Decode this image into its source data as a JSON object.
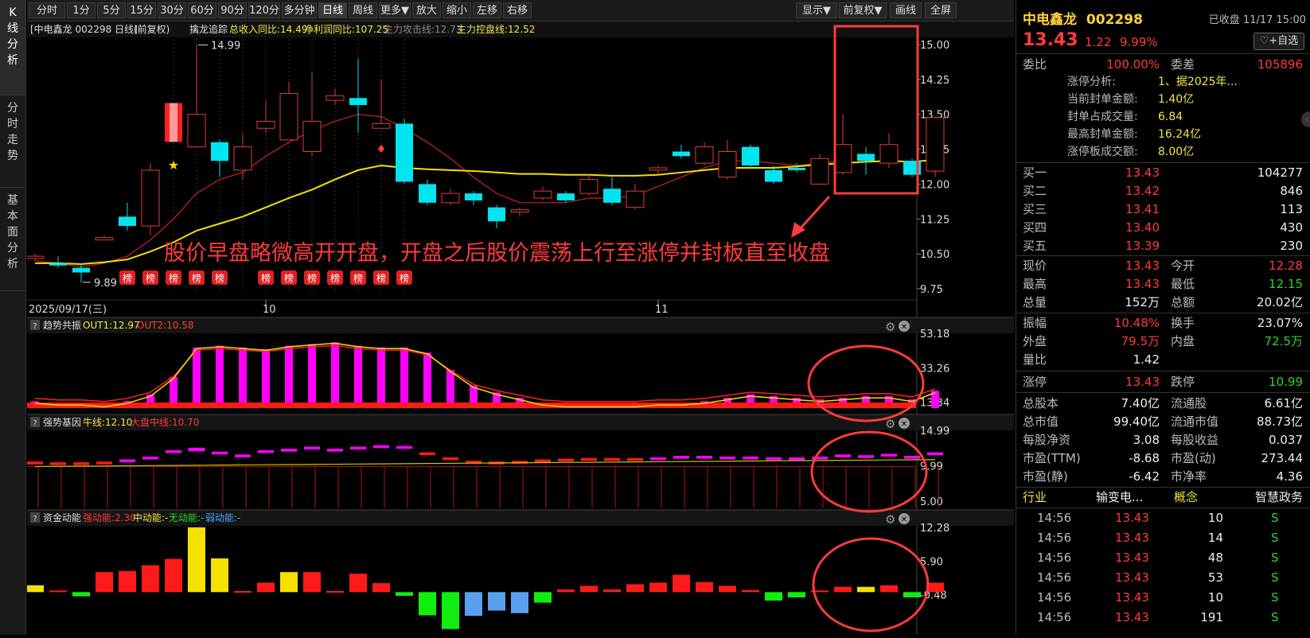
{
  "left_tabs": [
    {
      "label": [
        "K",
        "线",
        "分",
        "析"
      ],
      "active": true
    },
    {
      "label": [
        "分",
        "时",
        "走",
        "势"
      ],
      "active": false
    },
    {
      "label": [
        "基",
        "本",
        "面",
        "分",
        "析"
      ],
      "active": false
    }
  ],
  "toolbar": {
    "left_buttons": [
      "分时",
      "1分",
      "5分",
      "15分",
      "30分",
      "60分",
      "90分",
      "120分",
      "多分钟",
      "日线",
      "周线",
      "更多▼",
      "放大",
      "缩小",
      "左移",
      "右移"
    ],
    "active": "日线",
    "right_buttons": [
      "显示▼",
      "前复权▼",
      "画线",
      "全屏"
    ]
  },
  "main_chart": {
    "header_name": "[中电鑫龙 002298 日线]",
    "header_adj": "(前复权)",
    "indicator_name": "擒龙追踪",
    "ind1": "总收入同比:14.49",
    "ind2": "净利润同比:107.25",
    "ind3": "主力攻击线:12.73",
    "ind4": "主力控盘线:12.52",
    "y_ticks": [
      "15.00",
      "14.25",
      "13.50",
      "12.75",
      "12.00",
      "11.25",
      "10.50",
      "9.75"
    ],
    "high_label": "14.99",
    "low_label": "9.89",
    "annotation": "股价早盘略微高开开盘，开盘之后股价震荡上行至涨停并封板直至收盘",
    "bang_label": "榜",
    "date_start": "2025/09/17(三)",
    "month_10": "10",
    "month_11": "11"
  },
  "sub1": {
    "name": "趋势共振",
    "out1": "OUT1:12.97",
    "out2": "OUT2:10.58",
    "ticks": [
      "53.18",
      "33.26",
      "13.34"
    ]
  },
  "sub2": {
    "name": "强势基因",
    "l1": "牛线:12.10",
    "l2": "大盘中线:10.70",
    "ticks": [
      "14.99",
      "9.99",
      "5.00"
    ]
  },
  "sub3": {
    "name": "资金动能",
    "l1": "强动能:2.30",
    "l2": "中动能:-",
    "l3": "无动能:-",
    "l4": "弱动能:-",
    "ticks": [
      "12.28",
      "5.90",
      "-0.48"
    ]
  },
  "panel": {
    "name": "中电鑫龙",
    "code": "002298",
    "status": "已收盘 11/17 15:00",
    "price": "13.43",
    "change": "1.22",
    "pct": "9.99%",
    "add_btn": "+自选",
    "weibi_l": "委比",
    "weibi_v": "100.00%",
    "weicha_l": "委差",
    "weicha_v": "105896",
    "zt_lines": [
      {
        "k": "涨停分析:",
        "v": "1、据2025年..."
      },
      {
        "k": "当前封单金额:",
        "v": "1.40亿"
      },
      {
        "k": "封单占成交量:",
        "v": "6.84"
      },
      {
        "k": "最高封单金额:",
        "v": "16.24亿"
      },
      {
        "k": "涨停板成交额:",
        "v": "8.00亿"
      }
    ],
    "bids": [
      {
        "k": "买一",
        "p": "13.43",
        "v": "104277"
      },
      {
        "k": "买二",
        "p": "13.42",
        "v": "846"
      },
      {
        "k": "买三",
        "p": "13.41",
        "v": "113"
      },
      {
        "k": "买四",
        "p": "13.40",
        "v": "430"
      },
      {
        "k": "买五",
        "p": "13.39",
        "v": "230"
      }
    ],
    "stats1": [
      {
        "k1": "现价",
        "v1": "13.43",
        "c1": "red",
        "k2": "今开",
        "v2": "12.28",
        "c2": "red"
      },
      {
        "k1": "最高",
        "v1": "13.43",
        "c1": "red",
        "k2": "最低",
        "v2": "12.15",
        "c2": "green"
      },
      {
        "k1": "总量",
        "v1": "152万",
        "c1": "white",
        "k2": "总额",
        "v2": "20.02亿",
        "c2": "white"
      }
    ],
    "stats2": [
      {
        "k1": "振幅",
        "v1": "10.48%",
        "c1": "red",
        "k2": "换手",
        "v2": "23.07%",
        "c2": "white"
      },
      {
        "k1": "外盘",
        "v1": "79.5万",
        "c1": "red",
        "k2": "内盘",
        "v2": "72.5万",
        "c2": "green"
      },
      {
        "k1": "量比",
        "v1": "1.42",
        "c1": "white",
        "k2": "",
        "v2": "",
        "c2": "white"
      }
    ],
    "limit": {
      "k1": "涨停",
      "v1": "13.43",
      "k2": "跌停",
      "v2": "10.99"
    },
    "stats3": [
      {
        "k1": "总股本",
        "v1": "7.40亿",
        "k2": "流通股",
        "v2": "6.61亿"
      },
      {
        "k1": "总市值",
        "v1": "99.40亿",
        "k2": "流通市值",
        "v2": "88.73亿"
      },
      {
        "k1": "每股净资",
        "v1": "3.08",
        "k2": "每股收益",
        "v2": "0.037"
      },
      {
        "k1": "市盈(TTM)",
        "v1": "-8.68",
        "k2": "市盈(动)",
        "v2": "273.44"
      },
      {
        "k1": "市盈(静)",
        "v1": "-6.42",
        "k2": "市净率",
        "v2": "4.36"
      }
    ],
    "industry": {
      "k1": "行业",
      "v1": "输变电...",
      "k2": "概念",
      "v2": "智慧政务"
    },
    "ticks": [
      {
        "t": "14:56",
        "p": "13.43",
        "v": "10",
        "s": "S"
      },
      {
        "t": "14:56",
        "p": "13.43",
        "v": "14",
        "s": "S"
      },
      {
        "t": "14:56",
        "p": "13.43",
        "v": "48",
        "s": "S"
      },
      {
        "t": "14:56",
        "p": "13.43",
        "v": "53",
        "s": "S"
      },
      {
        "t": "14:56",
        "p": "13.43",
        "v": "10",
        "s": "S"
      },
      {
        "t": "14:56",
        "p": "13.43",
        "v": "191",
        "s": "S"
      }
    ]
  },
  "chart_data": {
    "type": "candlestick",
    "ylim": [
      9.75,
      15.0
    ],
    "candles": [
      [
        10.4,
        10.45,
        10.5,
        10.35
      ],
      [
        10.3,
        10.25,
        10.45,
        10.2
      ],
      [
        10.2,
        10.1,
        10.3,
        9.89
      ],
      [
        10.8,
        10.85,
        10.9,
        10.8
      ],
      [
        11.3,
        11.1,
        11.6,
        11.0
      ],
      [
        11.1,
        12.3,
        12.45,
        10.9
      ],
      [
        13.25,
        13.4,
        13.45,
        13.25
      ],
      [
        12.8,
        13.5,
        14.99,
        12.8
      ],
      [
        12.9,
        12.5,
        12.95,
        12.15
      ],
      [
        12.3,
        12.8,
        13.1,
        12.1
      ],
      [
        13.2,
        13.35,
        13.8,
        13.1
      ],
      [
        12.95,
        13.95,
        14.2,
        12.95
      ],
      [
        12.7,
        13.35,
        14.4,
        12.6
      ],
      [
        13.8,
        13.9,
        14.05,
        13.7
      ],
      [
        13.85,
        13.7,
        14.7,
        13.1
      ],
      [
        13.2,
        13.3,
        14.25,
        13.2
      ],
      [
        13.3,
        12.05,
        13.4,
        12.0
      ],
      [
        12.0,
        11.6,
        12.1,
        11.55
      ],
      [
        11.6,
        11.8,
        11.9,
        11.55
      ],
      [
        11.8,
        11.65,
        11.85,
        11.55
      ],
      [
        11.5,
        11.2,
        11.55,
        11.05
      ],
      [
        11.4,
        11.45,
        11.5,
        11.3
      ],
      [
        11.7,
        11.85,
        11.95,
        11.65
      ],
      [
        11.8,
        11.65,
        11.85,
        11.6
      ],
      [
        11.8,
        12.1,
        12.2,
        11.75
      ],
      [
        11.9,
        11.6,
        12.15,
        11.55
      ],
      [
        11.5,
        11.85,
        12.0,
        11.45
      ],
      [
        12.3,
        12.35,
        12.4,
        12.2
      ],
      [
        12.7,
        12.6,
        12.85,
        12.55
      ],
      [
        12.45,
        12.8,
        12.9,
        12.4
      ],
      [
        12.15,
        12.7,
        12.95,
        12.1
      ],
      [
        12.8,
        12.4,
        12.85,
        12.35
      ],
      [
        12.3,
        12.05,
        12.4,
        12.0
      ],
      [
        12.35,
        12.3,
        12.45,
        12.25
      ],
      [
        12.0,
        12.55,
        12.65,
        12.0
      ],
      [
        12.25,
        12.85,
        13.5,
        12.2
      ],
      [
        12.65,
        12.5,
        12.8,
        12.2
      ],
      [
        12.45,
        12.85,
        13.1,
        12.35
      ],
      [
        12.5,
        12.2,
        12.55,
        12.15
      ],
      [
        12.28,
        13.43,
        13.43,
        12.15
      ]
    ],
    "ma_yellow": [
      10.3,
      10.3,
      10.28,
      10.32,
      10.38,
      10.55,
      10.75,
      11.0,
      11.15,
      11.3,
      11.5,
      11.7,
      11.88,
      12.1,
      12.3,
      12.4,
      12.35,
      12.32,
      12.3,
      12.28,
      12.25,
      12.22,
      12.22,
      12.2,
      12.2,
      12.18,
      12.18,
      12.2,
      12.25,
      12.3,
      12.35,
      12.35,
      12.35,
      12.38,
      12.42,
      12.45,
      12.48,
      12.5,
      12.48,
      12.52
    ],
    "ma_red": [
      10.35,
      10.3,
      10.22,
      10.3,
      10.45,
      10.8,
      11.25,
      11.8,
      12.1,
      12.25,
      12.6,
      12.9,
      13.15,
      13.35,
      13.5,
      13.45,
      13.2,
      12.9,
      12.55,
      12.15,
      11.8,
      11.6,
      11.6,
      11.6,
      11.7,
      11.7,
      11.75,
      11.95,
      12.15,
      12.35,
      12.5,
      12.5,
      12.45,
      12.4,
      12.45,
      12.5,
      12.55,
      12.55,
      12.45,
      12.73
    ],
    "sub1_bars": [
      14,
      13,
      13,
      12,
      14,
      18,
      28,
      45,
      46,
      45,
      44,
      46,
      47,
      48,
      46,
      45,
      45,
      42,
      32,
      23,
      19,
      16,
      13,
      12,
      12,
      12,
      12,
      13,
      13,
      14,
      16,
      18,
      17,
      16,
      15,
      16,
      17,
      17,
      15,
      20
    ],
    "sub2_bars": [
      10.2,
      10.1,
      10.1,
      10.2,
      10.5,
      10.9,
      11.8,
      12.1,
      11.6,
      11.2,
      11.8,
      12.0,
      12.3,
      12.0,
      12.3,
      12.5,
      12.4,
      11.5,
      10.8,
      10.3,
      10.2,
      10.3,
      10.5,
      10.6,
      10.7,
      10.7,
      10.7,
      10.8,
      11.0,
      11.0,
      10.9,
      10.9,
      10.8,
      10.8,
      10.9,
      11.2,
      11.1,
      11.3,
      11.0,
      11.5
    ],
    "sub3_bars": [
      1.3,
      0.3,
      -0.8,
      3.8,
      4.0,
      5.1,
      6.3,
      12.3,
      6.4,
      0.2,
      1.8,
      3.8,
      3.8,
      0.2,
      3.5,
      1.7,
      -0.7,
      -4.4,
      -7.0,
      -4.5,
      -3.5,
      -4.0,
      -2.0,
      0.5,
      1.2,
      0.5,
      1.5,
      1.8,
      3.3,
      1.9,
      1.2,
      0.4,
      -1.6,
      -1.0,
      0.3,
      1.0,
      1.0,
      1.3,
      -1.0,
      1.8
    ]
  }
}
